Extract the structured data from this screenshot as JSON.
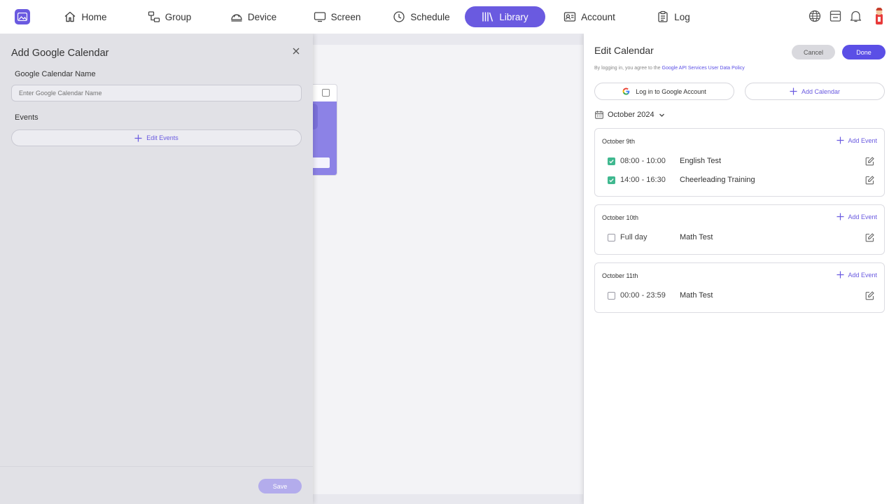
{
  "nav": {
    "items": [
      {
        "label": "Home",
        "icon": "home-icon"
      },
      {
        "label": "Group",
        "icon": "group-icon"
      },
      {
        "label": "Device",
        "icon": "device-icon"
      },
      {
        "label": "Screen",
        "icon": "screen-icon"
      },
      {
        "label": "Schedule",
        "icon": "clock-icon"
      },
      {
        "label": "Library",
        "icon": "library-icon",
        "active": true
      },
      {
        "label": "Account",
        "icon": "account-icon"
      },
      {
        "label": "Log",
        "icon": "log-icon"
      }
    ],
    "accent": "#6a5ae0"
  },
  "left_panel": {
    "title": "Add Google Calendar",
    "name_label": "Google Calendar Name",
    "name_placeholder": "Enter Google Calendar Name",
    "events_label": "Events",
    "edit_events_label": "Edit Events",
    "save_label": "Save"
  },
  "right_panel": {
    "title": "Edit Calendar",
    "cancel_label": "Cancel",
    "done_label": "Done",
    "policy_prefix": "By logging in, you agree to the",
    "policy_link": "Google API Services User Data Policy",
    "google_login_label": "Log in to Google Account",
    "add_calendar_label": "Add Calendar",
    "month": "October 2024",
    "days": [
      {
        "date": "October 9th",
        "add_label": "Add Event",
        "events": [
          {
            "time": "08:00 - 10:00",
            "name": "English Test",
            "checked": true
          },
          {
            "time": "14:00 - 16:30",
            "name": "Cheerleading Training",
            "checked": true
          }
        ]
      },
      {
        "date": "October 10th",
        "add_label": "Add Event",
        "events": [
          {
            "time": "Full day",
            "name": "Math Test",
            "checked": false
          }
        ]
      },
      {
        "date": "October 11th",
        "add_label": "Add Event",
        "events": [
          {
            "time": "00:00 - 23:59",
            "name": "Math Test",
            "checked": false
          }
        ]
      }
    ]
  }
}
